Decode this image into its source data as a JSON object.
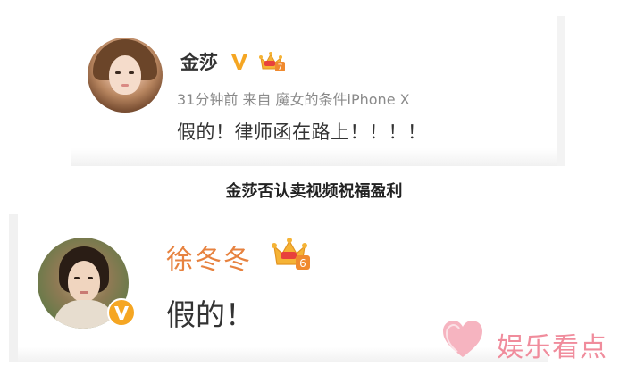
{
  "post1": {
    "username": "金莎",
    "verified_icon": "verified-v-icon",
    "level_icon": "crown-level-icon",
    "level": "7",
    "meta": "31分钟前 来自 魔女的条件iPhone X",
    "content": "假的！律师函在路上！！！！"
  },
  "caption": "金莎否认卖视频祝福盈利",
  "post2": {
    "username": "徐冬冬",
    "verified_icon": "verified-v-icon",
    "level_icon": "crown-level-icon",
    "level": "6",
    "content": "假的！"
  },
  "watermark": {
    "text": "娱乐看点",
    "icon": "heart-logo-icon"
  },
  "colors": {
    "name_orange": "#e7823f",
    "crown_gold": "#f5a623",
    "verified_orange": "#f5a623",
    "watermark_pink": "#f08c9c",
    "meta_gray": "#8a8a8a"
  }
}
